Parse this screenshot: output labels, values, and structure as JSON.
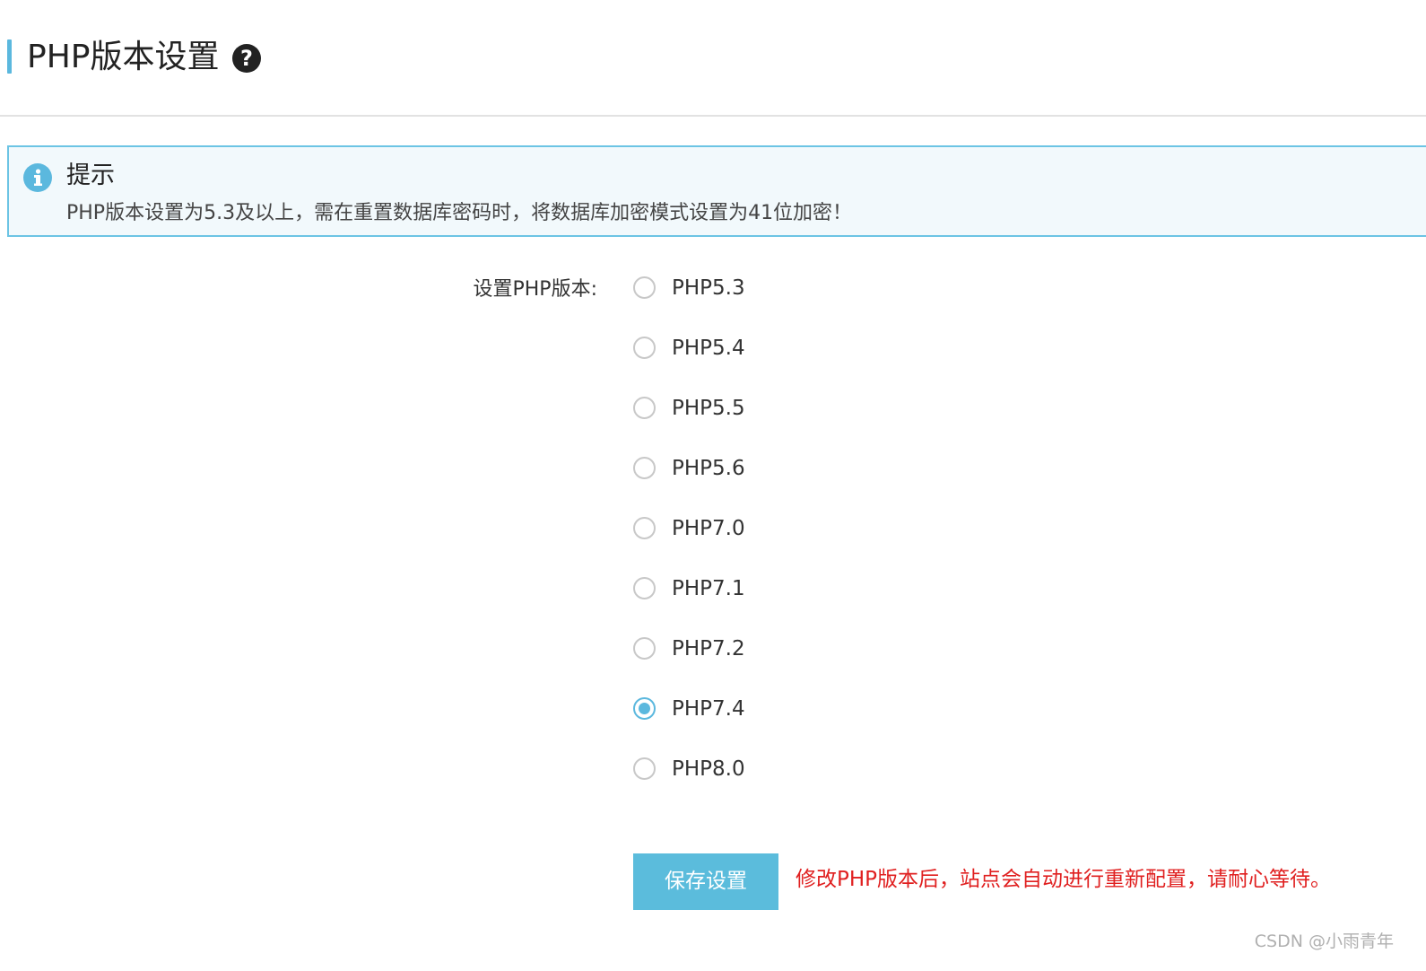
{
  "header": {
    "title": "PHP版本设置",
    "help_icon": "question-circle-icon",
    "help_glyph": "?"
  },
  "alert": {
    "icon": "info-circle-icon",
    "title": "提示",
    "message": "PHP版本设置为5.3及以上，需在重置数据库密码时，将数据库加密模式设置为41位加密！"
  },
  "form": {
    "label": "设置PHP版本:",
    "selected": "PHP7.4",
    "options": [
      {
        "label": "PHP5.3",
        "checked": false
      },
      {
        "label": "PHP5.4",
        "checked": false
      },
      {
        "label": "PHP5.5",
        "checked": false
      },
      {
        "label": "PHP5.6",
        "checked": false
      },
      {
        "label": "PHP7.0",
        "checked": false
      },
      {
        "label": "PHP7.1",
        "checked": false
      },
      {
        "label": "PHP7.2",
        "checked": false
      },
      {
        "label": "PHP7.4",
        "checked": true
      },
      {
        "label": "PHP8.0",
        "checked": false
      }
    ]
  },
  "actions": {
    "save_label": "保存设置",
    "note": "修改PHP版本后，站点会自动进行重新配置，请耐心等待。"
  },
  "watermark": "CSDN @小雨青年",
  "colors": {
    "accent": "#5bb8de",
    "button": "#5bbcdc",
    "warning_text": "#e02020",
    "alert_bg": "#f2f9fc",
    "alert_border": "#6cc4e4"
  }
}
